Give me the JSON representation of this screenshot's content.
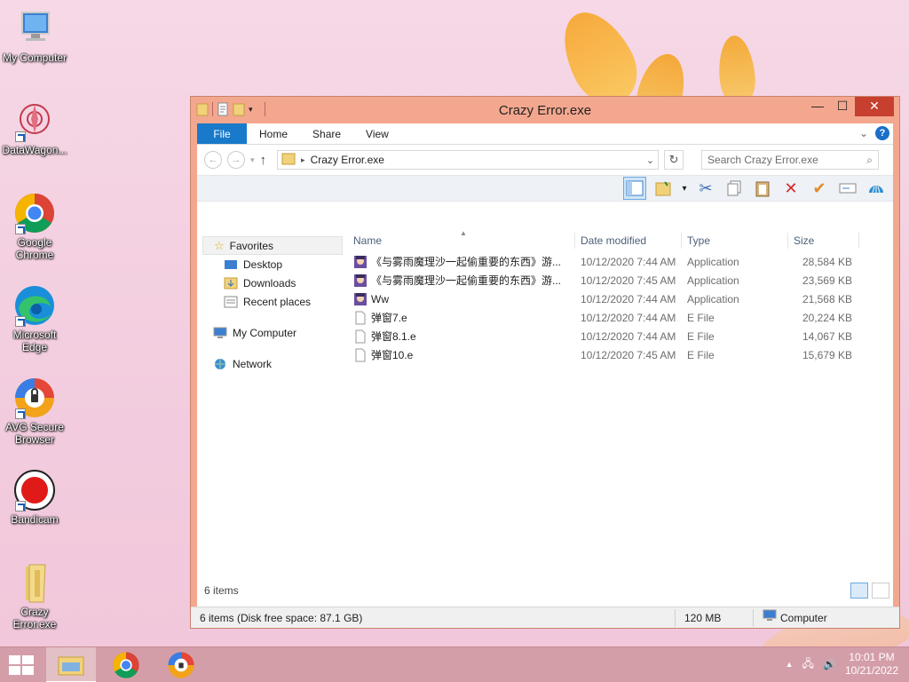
{
  "desktop": {
    "icons": [
      {
        "label": "My Computer"
      },
      {
        "label": "DataWagon..."
      },
      {
        "label": "Google Chrome"
      },
      {
        "label": "Microsoft Edge"
      },
      {
        "label": "AVG Secure Browser"
      },
      {
        "label": "Bandicam"
      },
      {
        "label": "Crazy Error.exe"
      }
    ]
  },
  "window": {
    "title": "Crazy Error.exe",
    "controls": {
      "minimize": "—",
      "maximize": "☐",
      "close": "✕"
    },
    "ribbon": {
      "tabs": [
        "File",
        "Home",
        "Share",
        "View"
      ]
    },
    "address": {
      "path": "Crazy Error.exe"
    },
    "search": {
      "placeholder": "Search Crazy Error.exe"
    },
    "nav": {
      "favorites": "Favorites",
      "favorites_items": [
        "Desktop",
        "Downloads",
        "Recent places"
      ],
      "computer": "My Computer",
      "network": "Network"
    },
    "columns": {
      "name": "Name",
      "date": "Date modified",
      "type": "Type",
      "size": "Size"
    },
    "files": [
      {
        "name": "《与雾雨魔理沙一起偷重要的东西》游...",
        "date": "10/12/2020 7:44 AM",
        "type": "Application",
        "size": "28,584 KB",
        "icon": "app-icon"
      },
      {
        "name": "《与雾雨魔理沙一起偷重要的东西》游...",
        "date": "10/12/2020 7:45 AM",
        "type": "Application",
        "size": "23,569 KB",
        "icon": "app-icon"
      },
      {
        "name": "Ww",
        "date": "10/12/2020 7:44 AM",
        "type": "Application",
        "size": "21,568 KB",
        "icon": "app-icon"
      },
      {
        "name": "弹窗7.e",
        "date": "10/12/2020 7:44 AM",
        "type": "E File",
        "size": "20,224 KB",
        "icon": "file-icon"
      },
      {
        "name": "弹窗8.1.e",
        "date": "10/12/2020 7:44 AM",
        "type": "E File",
        "size": "14,067 KB",
        "icon": "file-icon"
      },
      {
        "name": "弹窗10.e",
        "date": "10/12/2020 7:45 AM",
        "type": "E File",
        "size": "15,679 KB",
        "icon": "file-icon"
      }
    ],
    "item_count": "6 items",
    "infobar": {
      "summary": "6 items (Disk free space: 87.1 GB)",
      "size": "120 MB",
      "location": "Computer"
    }
  },
  "taskbar": {
    "clock_time": "10:01 PM",
    "clock_date": "10/21/2022"
  },
  "colors": {
    "accent": "#1979ca",
    "window_frame": "#f3a78e",
    "close": "#c7402f"
  }
}
